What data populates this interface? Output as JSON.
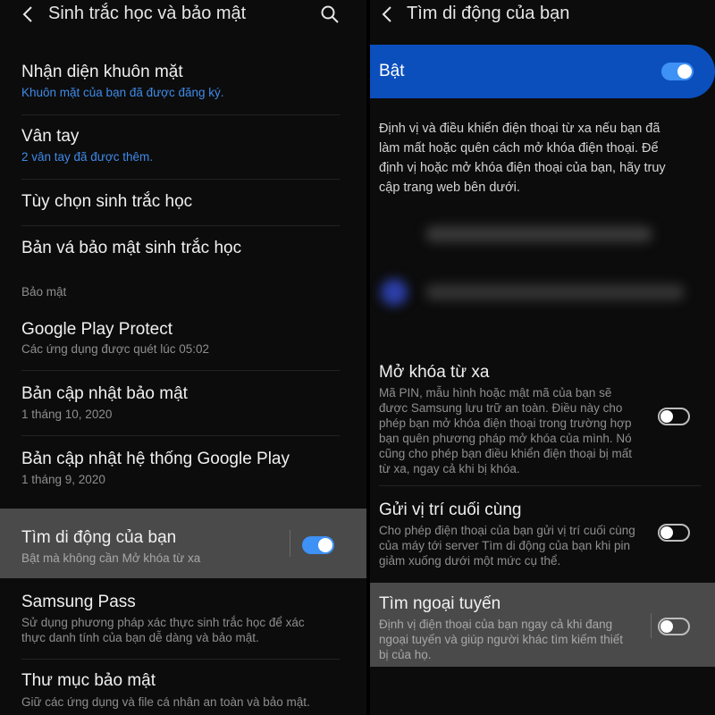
{
  "left": {
    "title": "Sinh trắc học và bảo mật",
    "items": [
      {
        "title": "Nhận diện khuôn mặt",
        "subtitle": "Khuôn mặt của bạn đã được đăng ký."
      },
      {
        "title": "Vân tay",
        "subtitle": "2 vân tay đã được thêm."
      },
      {
        "title": "Tùy chọn sinh trắc học"
      },
      {
        "title": "Bản vá bảo mật sinh trắc học"
      }
    ],
    "section_label": "Bảo mật",
    "security_items": [
      {
        "title": "Google Play Protect",
        "subtitle": "Các ứng dụng được quét lúc 05:02"
      },
      {
        "title": "Bản cập nhật bảo mật",
        "subtitle": "1 tháng 10, 2020"
      },
      {
        "title": "Bản cập nhật hệ thống Google Play",
        "subtitle": "1 tháng 9, 2020"
      },
      {
        "title": "Tìm di động của bạn",
        "subtitle": "Bật mà không cần Mở khóa từ xa",
        "toggle": "on"
      },
      {
        "title": "Samsung Pass",
        "subtitle": "Sử dụng phương pháp xác thực sinh trắc học để xác",
        "subtitle2": "thực danh tính của bạn dễ dàng và bảo mật."
      },
      {
        "title": "Thư mục bảo mật",
        "subtitle": "Giữ các ứng dụng và file cá nhân an toàn và bảo mật."
      }
    ]
  },
  "right": {
    "title": "Tìm di động của bạn",
    "master": {
      "label": "Bật",
      "toggle": "on"
    },
    "description_lines": [
      "Định vị và điều khiển điện thoại từ xa nếu bạn đã",
      "làm mất hoặc quên cách mở khóa điện thoại. Để",
      "định vị hoặc mở khóa điện thoại của bạn, hãy truy",
      "cập trang web bên dưới."
    ],
    "options": [
      {
        "title": "Mở khóa từ xa",
        "toggle": "off",
        "lines": [
          "Mã PIN, mẫu hình hoặc mật mã của bạn sẽ",
          "được Samsung lưu trữ an toàn. Điều này cho",
          "phép bạn mở khóa điện thoại trong trường hợp",
          "bạn quên phương pháp mở khóa của mình. Nó",
          "cũng cho phép bạn điều khiển điện thoại bị mất",
          "từ xa, ngay cả khi bị khóa."
        ]
      },
      {
        "title": "Gửi vị trí cuối cùng",
        "toggle": "off",
        "lines": [
          "Cho phép điện thoại của bạn gửi vị trí cuối cùng",
          "của máy tới server Tìm di động của bạn khi pin",
          "giảm xuống dưới một mức cụ thể."
        ]
      },
      {
        "title": "Tìm ngoại tuyến",
        "toggle": "off",
        "lines": [
          "Định vị điện thoại của bạn ngay cả khi đang",
          "ngoại tuyến và giúp người khác tìm kiếm thiết",
          "bị của họ."
        ]
      }
    ]
  },
  "colors": {
    "accent": "#3e91f5",
    "banner": "#0b4fbd",
    "link_blue": "#3f8ae8",
    "selected": "#4a4a4a"
  }
}
